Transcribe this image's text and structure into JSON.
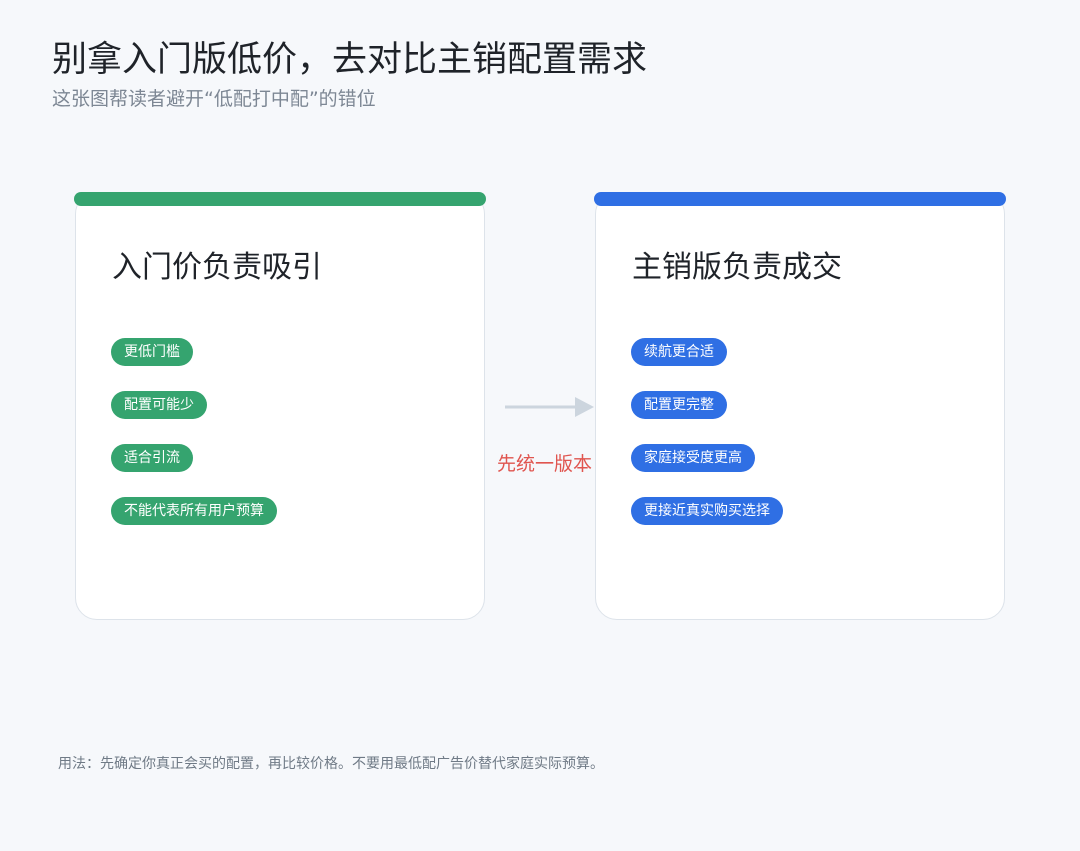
{
  "header": {
    "title": "别拿入门版低价，去对比主销配置需求",
    "subtitle": "这张图帮读者避开“低配打中配”的错位"
  },
  "cards": {
    "left": {
      "title": "入门价负责吸引",
      "accent": "#35a46f",
      "tags": [
        "更低门槛",
        "配置可能少",
        "适合引流",
        "不能代表所有用户预算"
      ]
    },
    "right": {
      "title": "主销版负责成交",
      "accent": "#2f6fe4",
      "tags": [
        "续航更合适",
        "配置更完整",
        "家庭接受度更高",
        "更接近真实购买选择"
      ]
    }
  },
  "connector": {
    "label": "先统一版本",
    "label_color": "#e0554f",
    "icon": "arrow-right-icon"
  },
  "footer": {
    "note": "用法：先确定你真正会买的配置，再比较价格。不要用最低配广告价替代家庭实际预算。"
  }
}
